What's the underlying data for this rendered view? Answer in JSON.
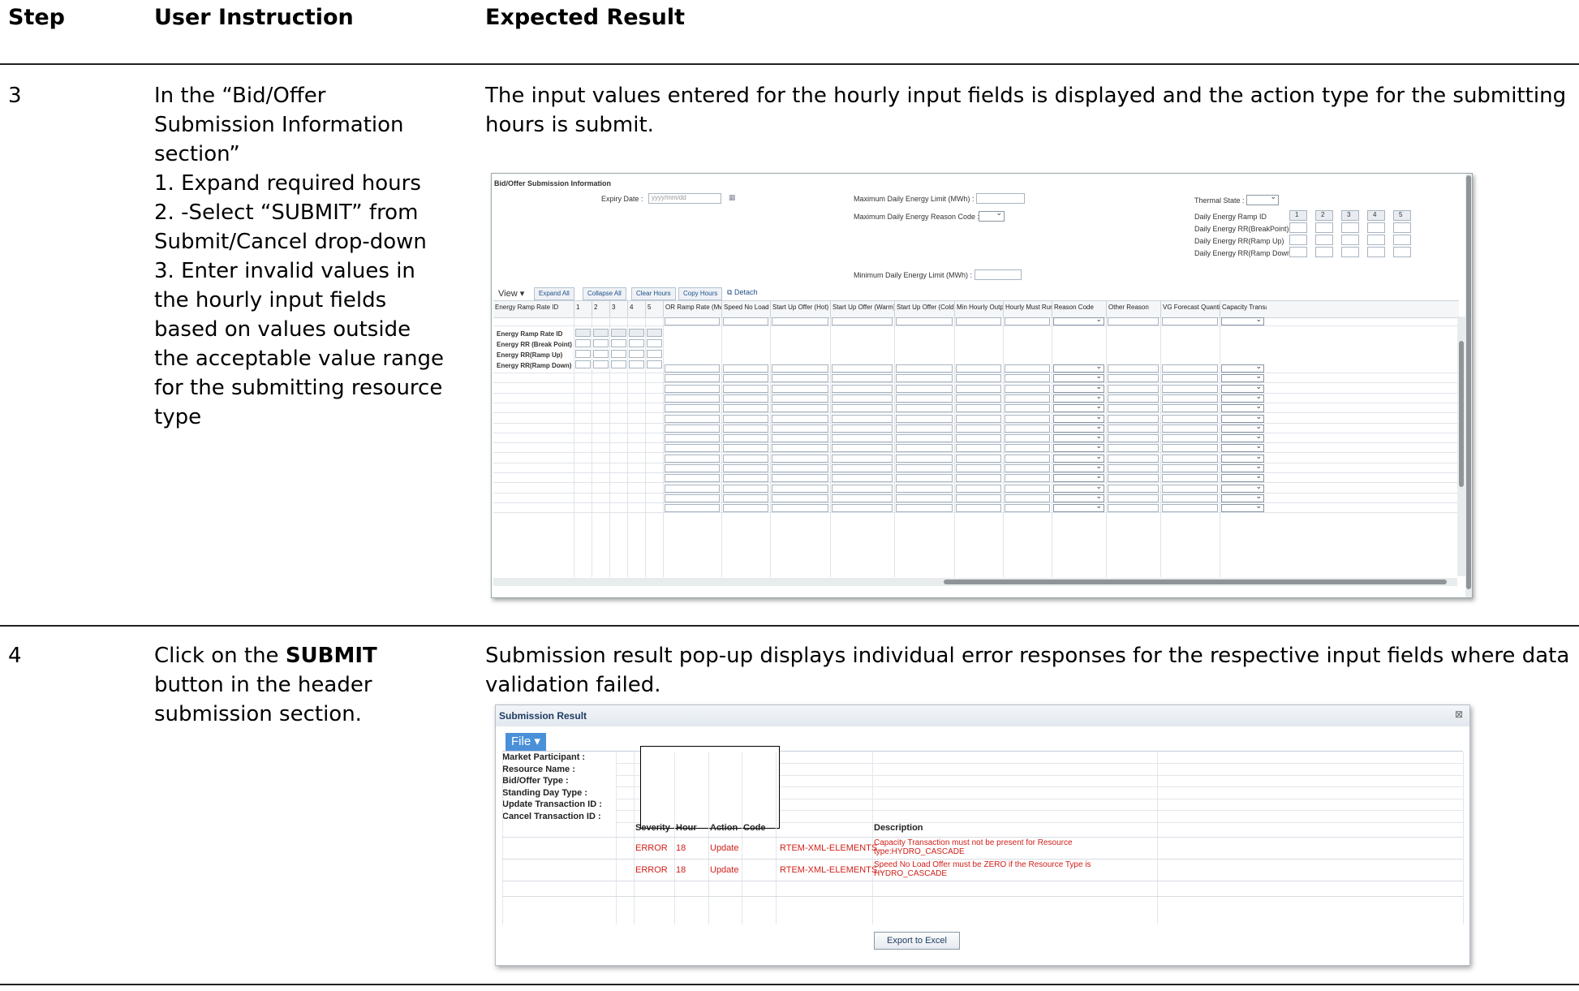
{
  "headers": {
    "step": "Step",
    "instruction": "User Instruction",
    "expected": "Expected Result"
  },
  "rows": [
    {
      "step": "3",
      "instruction_lines": [
        "In the “Bid/Offer",
        "Submission Information",
        "section”",
        "1. Expand required hours",
        "2. -Select “SUBMIT” from",
        "Submit/Cancel drop-down",
        "3. Enter invalid values in",
        "the hourly input fields",
        "based on values outside",
        "the acceptable value range",
        "for the submitting resource",
        "type"
      ],
      "expected_lines": [
        "The input values entered for the hourly input fields is displayed and the action type for the submitting",
        "hours is submit."
      ]
    },
    {
      "step": "4",
      "instruction_pre": "Click on the ",
      "instruction_bold": "SUBMIT",
      "instruction_lines": [
        "button in the header",
        "submission section."
      ],
      "expected_lines": [
        "Submission result pop-up displays individual error responses for the respective input fields where data",
        "validation failed."
      ]
    }
  ],
  "bid_offer": {
    "title": "Bid/Offer Submission Information",
    "expiry_label": "Expiry Date :",
    "expiry_placeholder": "yyyy/mm/dd",
    "max_daily_limit": "Maximum Daily Energy Limit (MWh) :",
    "max_daily_reason": "Maximum Daily Energy Reason Code :",
    "min_daily_limit": "Minimum Daily Energy Limit (MWh) :",
    "thermal_state": "Thermal State :",
    "ramp_id": "Daily Energy Ramp ID",
    "rr_breakpoint": "Daily Energy RR(BreakPoint)",
    "rr_ramp_up": "Daily Energy RR(Ramp Up)",
    "rr_ramp_down": "Daily Energy RR(Ramp Down)",
    "ramp_numbers": [
      "1",
      "2",
      "3",
      "4",
      "5"
    ],
    "toolbar": {
      "view": "View",
      "expand_all": "Expand All",
      "collapse_all": "Collapse All",
      "clear_hours": "Clear Hours",
      "copy_hours": "Copy Hours",
      "detach": "Detach"
    },
    "columns": [
      "Energy Ramp Rate ID",
      "1",
      "2",
      "3",
      "4",
      "5",
      "OR Ramp Rate (Mwh)",
      "Speed No Load",
      "Start Up Offer (Hot)",
      "Start Up Offer (Warm)",
      "Start Up Offer (Cold)",
      "Min Hourly Output",
      "Hourly Must Run",
      "Reason Code",
      "Other Reason",
      "VG Forecast Quantity",
      "Capacity Transaction Flag"
    ],
    "row_labels": [
      "Energy Ramp Rate ID",
      "Energy RR (Break Point)",
      "Energy RR(Ramp Up)",
      "Energy RR(Ramp Down)"
    ]
  },
  "submission_result": {
    "title": "Submission Result",
    "file_menu": "File",
    "fields": [
      "Market Participant :",
      "Resource Name :",
      "Bid/Offer Type :",
      "Standing Day Type :",
      "Update Transaction ID :",
      "Cancel Transaction ID :"
    ],
    "table_headers": [
      "Severity",
      "Hour",
      "Action",
      "Code",
      "Description"
    ],
    "errors": [
      {
        "severity": "ERROR",
        "hour": "18",
        "action": "Update",
        "code": "RTEM-XML-ELEMENTS...",
        "description": [
          "Capacity Transaction must not be present for Resource",
          "type:HYDRO_CASCADE"
        ]
      },
      {
        "severity": "ERROR",
        "hour": "18",
        "action": "Update",
        "code": "RTEM-XML-ELEMENTS...",
        "description": [
          "Speed No Load Offer must be ZERO if the Resource Type is",
          "HYDRO_CASCADE"
        ]
      }
    ],
    "export_button": "Export to Excel"
  }
}
